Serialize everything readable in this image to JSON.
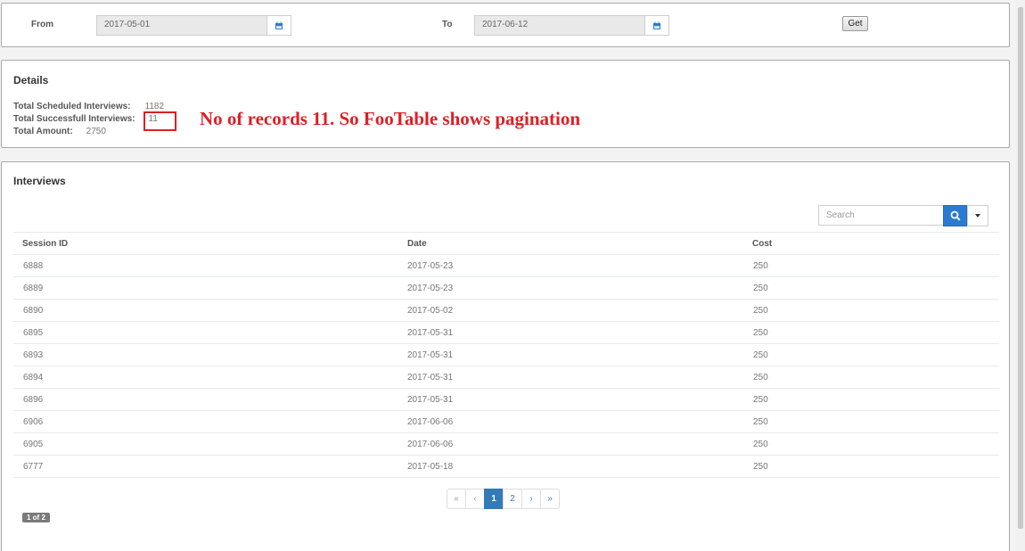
{
  "filter": {
    "from_label": "From",
    "from_value": "2017-05-01",
    "to_label": "To",
    "to_value": "2017-06-12",
    "get_label": "Get"
  },
  "details": {
    "title": "Details",
    "scheduled_label": "Total Scheduled Interviews:",
    "scheduled_value": "1182",
    "successful_label": "Total Successfull Interviews:",
    "successful_value": "11",
    "amount_label": "Total Amount:",
    "amount_value": "2750",
    "annotation": "No of records 11. So FooTable shows pagination",
    "annotation_color": "#dd1f26"
  },
  "interviews": {
    "title": "Interviews",
    "search_placeholder": "Search",
    "columns": [
      "Session ID",
      "Date",
      "Cost"
    ],
    "rows": [
      [
        "6888",
        "2017-05-23",
        "250"
      ],
      [
        "6889",
        "2017-05-23",
        "250"
      ],
      [
        "6890",
        "2017-05-02",
        "250"
      ],
      [
        "6895",
        "2017-05-31",
        "250"
      ],
      [
        "6893",
        "2017-05-31",
        "250"
      ],
      [
        "6894",
        "2017-05-31",
        "250"
      ],
      [
        "6896",
        "2017-05-31",
        "250"
      ],
      [
        "6906",
        "2017-06-06",
        "250"
      ],
      [
        "6905",
        "2017-06-06",
        "250"
      ],
      [
        "6777",
        "2017-05-18",
        "250"
      ]
    ],
    "pagination": {
      "first": "«",
      "prev": "‹",
      "pages": [
        "1",
        "2"
      ],
      "active_page": "1",
      "next": "›",
      "last": "»"
    },
    "page_count": "1 of 2"
  },
  "colors": {
    "accent": "#337ab7",
    "search_button": "#2a7bd1"
  },
  "icons": {
    "calendar": "calendar-icon",
    "search": "search-icon",
    "dropdown": "caret-down-icon"
  }
}
